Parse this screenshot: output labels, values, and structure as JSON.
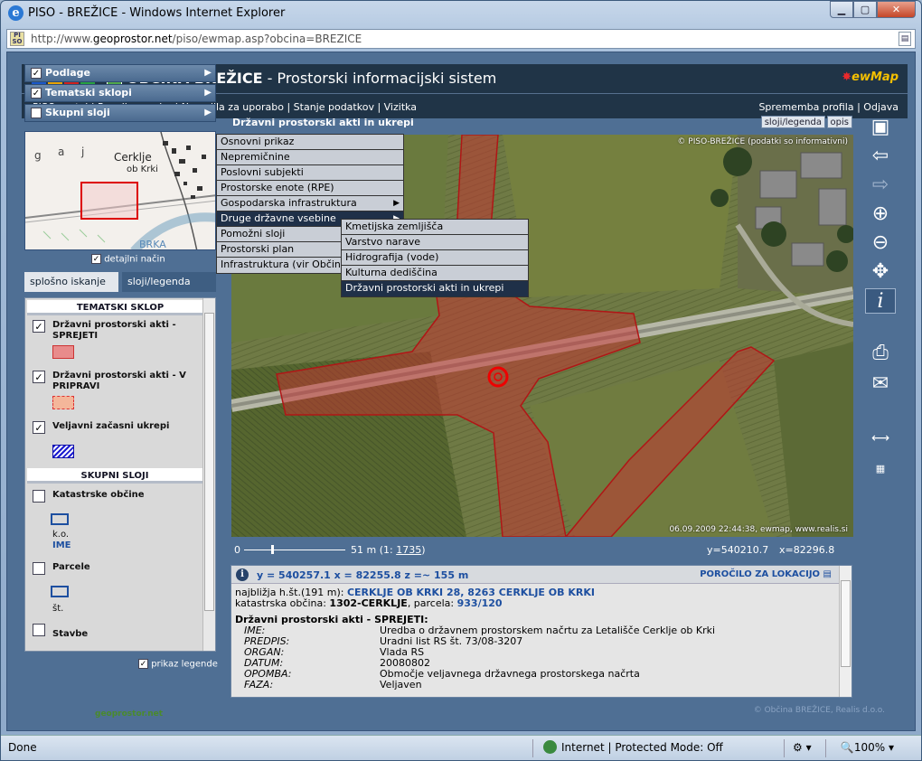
{
  "browser": {
    "title": "PISO - BREŽICE - Windows Internet Explorer",
    "url_prefix": "http://www.",
    "url_host": "geoprostor.net",
    "url_rest": "/piso/ewmap.asp?obcina=BREZICE",
    "status_left": "Done",
    "status_zone": "Internet | Protected Mode: Off",
    "zoom": "100%"
  },
  "app": {
    "logo_letters": [
      "P",
      "I",
      "S",
      "O"
    ],
    "title_bold": "OBČINA BREŽICE",
    "title_rest": " - Prostorski informacijski sistem",
    "brand": "ewMap",
    "nav_left": "PISO portal  |  Pogoji uporabe  |  Navodila za uporabo  |  Stanje podatkov  |  Vizitka",
    "nav_right": "Sprememba profila  |  Odjava",
    "copyright": "© Občina BREŽICE, Realis d.o.o."
  },
  "layers": {
    "podlage": "Podlage",
    "tematski": "Tematski sklopi",
    "skupni": "Skupni sloji",
    "detail": "detajlni način"
  },
  "tabs": {
    "t1": "splošno iskanje",
    "t2": "sloji/legenda"
  },
  "legend": {
    "sect1": "TEMATSKI SKLOP",
    "items": [
      {
        "label": "Državni prostorski akti - SPREJETI"
      },
      {
        "label": "Državni prostorski akti - V PRIPRAVI"
      },
      {
        "label": "Veljavni začasni ukrepi"
      }
    ],
    "sect2": "SKUPNI SLOJI",
    "items2": [
      {
        "label": "Katastrske občine",
        "sub1": "k.o.",
        "sub2": "IME"
      },
      {
        "label": "Parcele",
        "sub1": "št."
      },
      {
        "label": "Stavbe"
      }
    ],
    "footer": "prikaz legende"
  },
  "minimap": {
    "t1": "Cerklje",
    "t2": "ob Krki",
    "t3": "g",
    "t4": "a",
    "t5": "j",
    "t6": "BRKA"
  },
  "map": {
    "title": "Državni prostorski akti in ukrepi",
    "btn_layers": "sloji/legenda",
    "btn_desc": "opis",
    "copy": "© PISO-BREŽICE (podatki so informativni)",
    "stamp": "06.09.2009 22:44:38, ewmap, www.realis.si",
    "scale_zero": "0",
    "scale_text": "51 m (1: ",
    "scale_num": "1735",
    "scale_close": ")",
    "coord_y": "y=540210.7",
    "coord_x": "x=82296.8"
  },
  "menu1": [
    {
      "label": "Osnovni prikaz"
    },
    {
      "label": "Nepremičnine"
    },
    {
      "label": "Poslovni subjekti"
    },
    {
      "label": "Prostorske enote (RPE)"
    },
    {
      "label": "Gospodarska infrastruktura"
    },
    {
      "label": "Druge državne vsebine"
    },
    {
      "label": "Pomožni sloji"
    },
    {
      "label": "Prostorski plan"
    },
    {
      "label": "Infrastruktura (vir Občina)"
    }
  ],
  "menu2": [
    {
      "label": "Kmetijska zemljišča"
    },
    {
      "label": "Varstvo narave"
    },
    {
      "label": "Hidrografija (vode)"
    },
    {
      "label": "Kulturna dediščina"
    },
    {
      "label": "Državni prostorski akti in ukrepi"
    }
  ],
  "info": {
    "coords": "y = 540257.1   x = 82255.8   z =~ 155 m",
    "report": "POROČILO ZA LOKACIJO",
    "nearest_label": "najbližja h.št.(191 m): ",
    "nearest_val": "CERKLJE OB KRKI 28, 8263 CERKLJE OB KRKI",
    "ko_label": "katastrska občina: ",
    "ko_val": "1302-CERKLJE",
    "parc_label": ", parcela: ",
    "parc_val": "933/120",
    "section": "Državni prostorski akti - SPREJETI:",
    "rows": [
      {
        "k": "IME:",
        "v": "Uredba o državnem prostorskem načrtu za Letališče Cerklje ob Krki"
      },
      {
        "k": "PREDPIS:",
        "v": "Uradni list RS št. 73/08-3207"
      },
      {
        "k": "ORGAN:",
        "v": "Vlada RS"
      },
      {
        "k": "DATUM:",
        "v": "20080802"
      },
      {
        "k": "OPOMBA:",
        "v": "Območje veljavnega državnega prostorskega načrta"
      },
      {
        "k": "FAZA:",
        "v": "Veljaven"
      }
    ]
  },
  "colors": {
    "accent": "#1d4fa0",
    "plan": "#c8302f",
    "header": "#203447"
  },
  "geoprostor": "geoprostor.net"
}
